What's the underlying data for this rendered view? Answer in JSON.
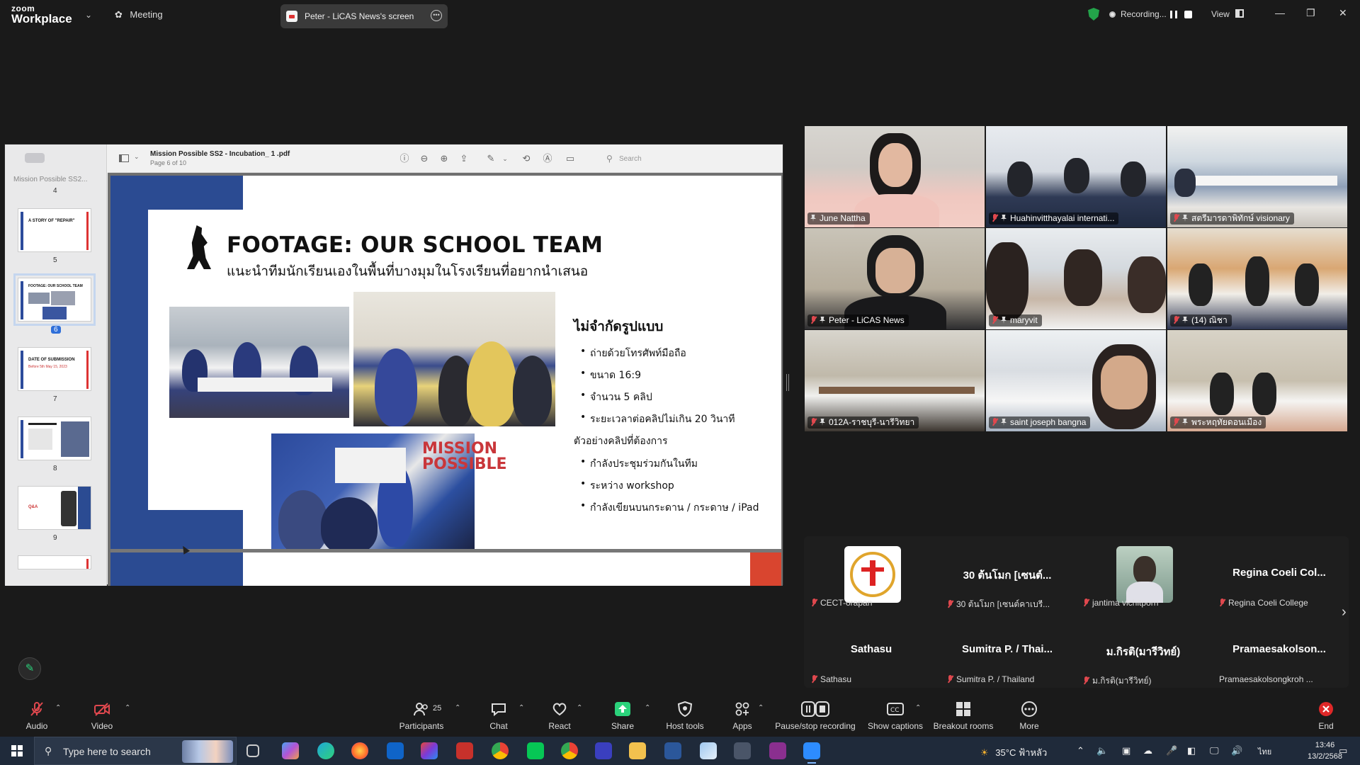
{
  "topbar": {
    "logo_line1": "zoom",
    "logo_line2": "Workplace",
    "meeting_label": "Meeting",
    "share_title": "Peter - LiCAS News's screen",
    "recording_label": "Recording...",
    "view_label": "View"
  },
  "pdf": {
    "sidebar_title": "Mission Possible SS2...",
    "file_title": "Mission Possible SS2 - Incubation_ 1 .pdf",
    "page_info": "Page 6 of 10",
    "search_placeholder": "Search",
    "thumbs": [
      {
        "num": "4",
        "text": "",
        "sub": ""
      },
      {
        "num": "5",
        "text": "A STORY OF \"REPAIR\"",
        "sub": ""
      },
      {
        "num": "6",
        "text": "FOOTAGE: OUR SCHOOL TEAM",
        "sub": ""
      },
      {
        "num": "7",
        "text": "DATE OF SUBMISSION",
        "sub": "Before 5th May 15, 2023"
      },
      {
        "num": "8",
        "text": "",
        "sub": ""
      },
      {
        "num": "9",
        "text": "Q&A",
        "sub": ""
      }
    ]
  },
  "slide": {
    "title": "FOOTAGE: OUR SCHOOL TEAM",
    "subtitle": "แนะนำทีมนักเรียนเองในพื้นที่บางมุมในโรงเรียนที่อยากนำเสนอ",
    "photo3_text_line1": "MISSION",
    "photo3_text_line2": "POSSIBLE",
    "right_heading": "ไม่จำกัดรูปแบบ",
    "right_items": [
      "ถ่ายด้วยโทรศัพท์มือถือ",
      "ขนาด  16:9",
      "จำนวน 5 คลิป",
      "ระยะเวลาต่อคลิปไม่เกิน 20 วินาที"
    ],
    "right_heading2": "ตัวอย่างคลิปที่ต้องการ",
    "right_items2": [
      "กำลังประชุมร่วมกันในทีม",
      "ระหว่าง workshop",
      "กำลังเขียนบนกระดาน / กระดาษ / iPad"
    ]
  },
  "video_tiles": [
    {
      "name": "June Nattha",
      "active": true
    },
    {
      "name": "Huahinvitthayalai internati...",
      "active": false
    },
    {
      "name": "สตรีมารดาพิทักษ์ visionary",
      "active": false
    },
    {
      "name": "Peter - LiCAS News",
      "active": false
    },
    {
      "name": "maryvit",
      "active": false
    },
    {
      "name": "(14) ณิชา",
      "active": false
    },
    {
      "name": "012A-ราชบุรี-นารีวิทยา",
      "active": false
    },
    {
      "name": "saint joseph bangna",
      "active": false
    },
    {
      "name": "พระหฤทัยดอนเมือง",
      "active": false
    }
  ],
  "participants_strip": [
    {
      "big": "",
      "small": "CECT-orapan",
      "muted": true,
      "avatar": "logo"
    },
    {
      "big": "30 ต้นโมก [เซนต์...",
      "small": "30 ต้นโมก [เซนต์คาเบรี...",
      "muted": true,
      "avatar": ""
    },
    {
      "big": "",
      "small": "jantima vichitporn",
      "muted": true,
      "avatar": "photo"
    },
    {
      "big": "Regina Coeli Col...",
      "small": "Regina Coeli College",
      "muted": true,
      "avatar": ""
    },
    {
      "big": "Sathasu",
      "small": "Sathasu",
      "muted": true,
      "avatar": ""
    },
    {
      "big": "Sumitra P. / Thai...",
      "small": "Sumitra P. / Thailand",
      "muted": true,
      "avatar": ""
    },
    {
      "big": "ม.กิรติ(มารีวิทย์)",
      "small": "ม.กิรติ(มารีวิทย์)",
      "muted": true,
      "avatar": ""
    },
    {
      "big": "Pramaesakolson...",
      "small": "Pramaesakolsongkroh ...",
      "muted": false,
      "avatar": ""
    }
  ],
  "controls": {
    "audio": "Audio",
    "video": "Video",
    "participants": "Participants",
    "participants_count": "25",
    "chat": "Chat",
    "react": "React",
    "share": "Share",
    "host_tools": "Host tools",
    "apps": "Apps",
    "pause_recording": "Pause/stop recording",
    "show_captions": "Show captions",
    "breakout_rooms": "Breakout rooms",
    "more": "More",
    "end": "End"
  },
  "taskbar": {
    "search_placeholder": "Type here to search",
    "weather": "35°C ฟ้าหลัว",
    "lang": "ไทย",
    "time": "13:46",
    "date": "13/2/2568"
  },
  "colors": {
    "zoom_green": "#2bd27b",
    "slide_blue": "#2b4b92",
    "mute_red": "#e0484e",
    "end_red": "#e02828"
  }
}
